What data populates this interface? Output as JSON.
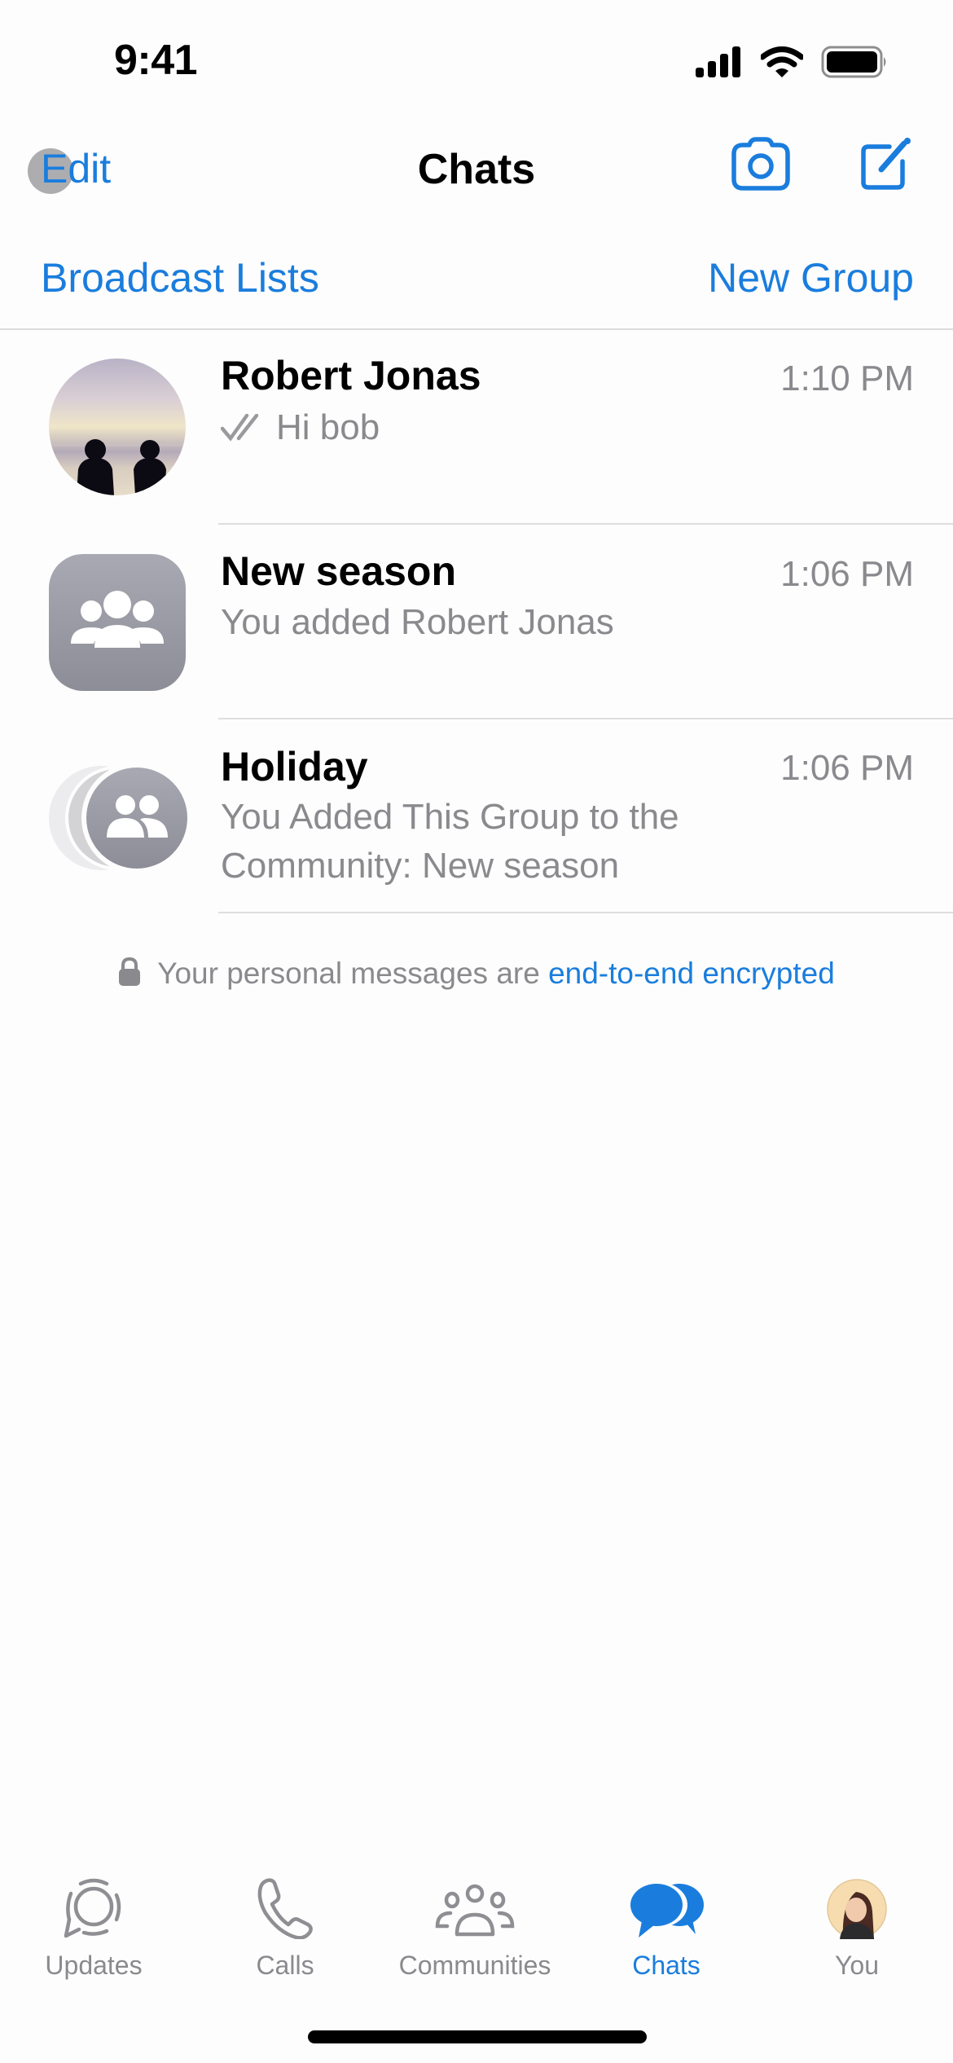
{
  "status_bar": {
    "time": "9:41",
    "icons": [
      "cellular-signal-icon",
      "wifi-icon",
      "battery-icon"
    ]
  },
  "nav": {
    "edit_label": "Edit",
    "title": "Chats",
    "camera_icon": "camera-icon",
    "compose_icon": "compose-icon"
  },
  "actions": {
    "broadcast_lists": "Broadcast Lists",
    "new_group": "New Group"
  },
  "chats": [
    {
      "name": "Robert Jonas",
      "time": "1:10 PM",
      "message": "Hi bob",
      "status_icon": "double-check-icon",
      "avatar": "photo"
    },
    {
      "name": "New season",
      "time": "1:06 PM",
      "message": "You added Robert Jonas",
      "avatar": "group-icon"
    },
    {
      "name": "Holiday",
      "time": "1:06 PM",
      "message_line1": "You Added This Group to the",
      "message_line2": "Community: New season",
      "avatar": "community-group-icon"
    }
  ],
  "notice": {
    "text": "Your personal messages are ",
    "link": "end-to-end encrypted"
  },
  "tabs": [
    {
      "label": "Updates",
      "icon": "updates-icon",
      "active": false
    },
    {
      "label": "Calls",
      "icon": "phone-icon",
      "active": false
    },
    {
      "label": "Communities",
      "icon": "communities-icon",
      "active": false
    },
    {
      "label": "Chats",
      "icon": "chats-icon",
      "active": true
    },
    {
      "label": "You",
      "icon": "profile-avatar",
      "active": false
    }
  ],
  "colors": {
    "accent": "#1a7ddd",
    "secondary_text": "#8a8a8e",
    "avatar_gray": "#9a9aa3"
  }
}
